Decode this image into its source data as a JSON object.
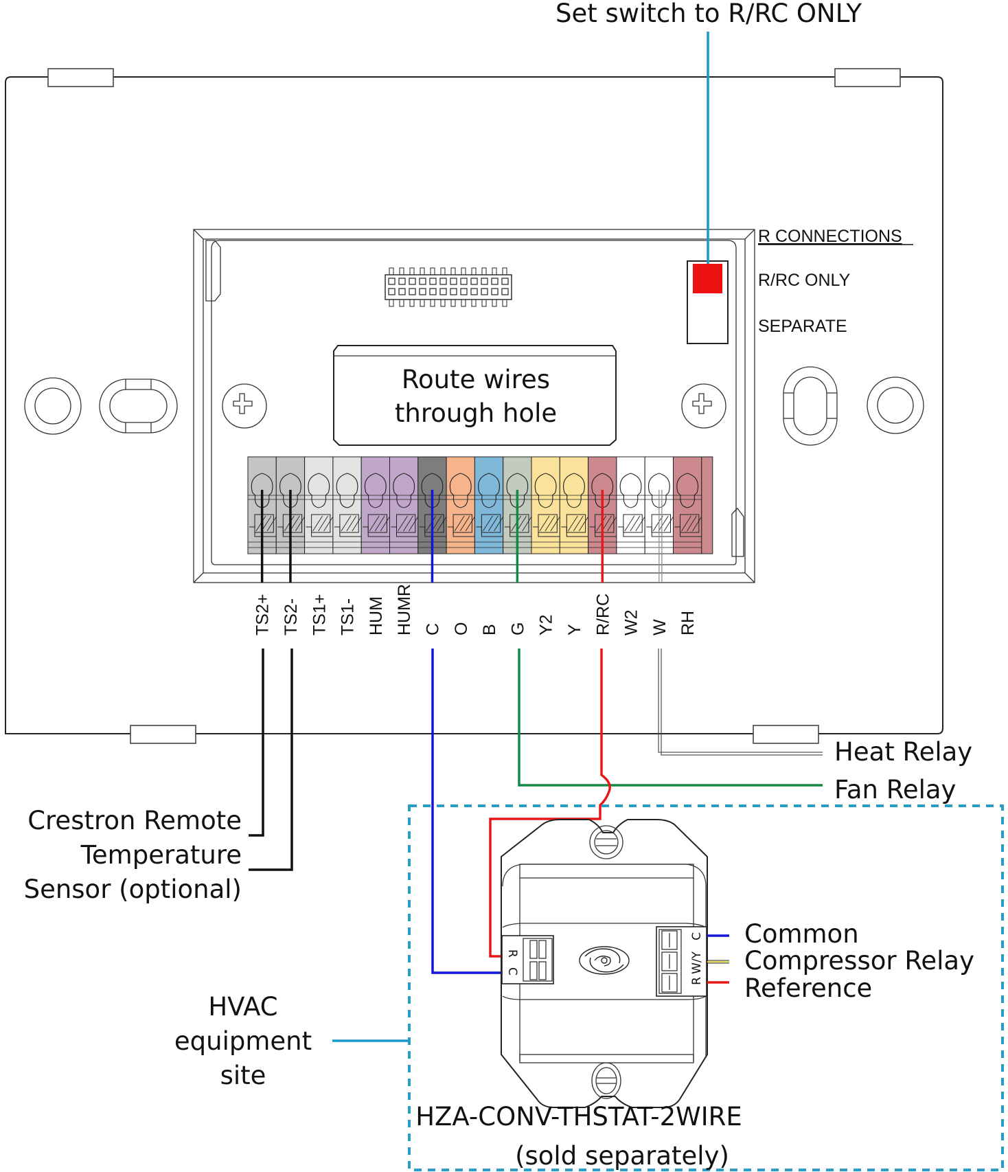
{
  "title_annotation": "Set switch to R/RC ONLY",
  "switch_panel": {
    "heading": "R CONNECTIONS",
    "options": [
      "R/RC ONLY",
      "SEPARATE"
    ],
    "selected": "R/RC ONLY"
  },
  "hole_label": [
    "Route wires",
    "through hole"
  ],
  "terminals": [
    {
      "label": "TS2+",
      "color": "#c4c4c4",
      "wire": "#111111"
    },
    {
      "label": "TS2-",
      "color": "#c4c4c4",
      "wire": "#111111"
    },
    {
      "label": "TS1+",
      "color": "#e3e3e3",
      "wire": null
    },
    {
      "label": "TS1-",
      "color": "#e3e3e3",
      "wire": null
    },
    {
      "label": "HUM",
      "color": "#c0a6c8",
      "wire": null
    },
    {
      "label": "HUMR",
      "color": "#c0a6c8",
      "wire": null
    },
    {
      "label": "C",
      "color": "#7d7d7d",
      "wire": "#1515d8"
    },
    {
      "label": "O",
      "color": "#f6b48c",
      "wire": null
    },
    {
      "label": "B",
      "color": "#7fb8d8",
      "wire": null
    },
    {
      "label": "G",
      "color": "#c3cbbe",
      "wire": "#128a44"
    },
    {
      "label": "Y2",
      "color": "#fbe29a",
      "wire": null
    },
    {
      "label": "Y",
      "color": "#fbe29a",
      "wire": null
    },
    {
      "label": "R/RC",
      "color": "#cc8a8e",
      "wire": "#e81818"
    },
    {
      "label": "W2",
      "color": "#ffffff",
      "wire": null
    },
    {
      "label": "W",
      "color": "#ffffff",
      "wire": "#888888"
    },
    {
      "label": "RH",
      "color": "#cc8a8e",
      "wire": null
    }
  ],
  "wire_labels": {
    "heat": "Heat Relay",
    "fan": "Fan Relay",
    "sensor": [
      "Crestron Remote",
      "Temperature",
      "Sensor (optional)"
    ],
    "hvac": [
      "HVAC",
      "equipment",
      "site"
    ]
  },
  "converter": {
    "model": "HZA-CONV-THSTAT-2WIRE",
    "note": "(sold separately)",
    "left_terminals": [
      "R",
      "C"
    ],
    "right_terminals": [
      "C",
      "W/Y",
      "R"
    ],
    "outputs": [
      {
        "label": "Common",
        "color": "#1515d8"
      },
      {
        "label": "Compressor Relay",
        "color": "#e8d84a"
      },
      {
        "label": "Reference",
        "color": "#e81818"
      }
    ]
  },
  "colors": {
    "callout": "#1a98d0",
    "switch_on": "#ee1111",
    "dashed_box": "#2a9cc8"
  }
}
